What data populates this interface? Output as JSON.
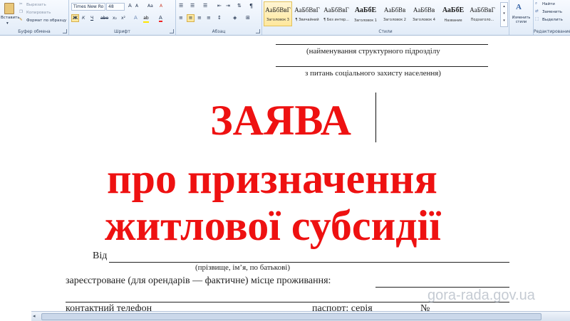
{
  "clipboard": {
    "paste": "Вставить",
    "cut": "Вырезать",
    "copy": "Копировать",
    "format_painter": "Формат по образцу",
    "label": "Буфер обмена"
  },
  "font": {
    "family": "Times New Ro",
    "size": "48",
    "label": "Шрифт",
    "bold": "Ж",
    "italic": "К",
    "underline": "Ч",
    "grow": "A",
    "shrink": "A",
    "case": "Aa",
    "clear": "A"
  },
  "paragraph": {
    "label": "Абзац",
    "pilcrow": "¶"
  },
  "styles": {
    "label": "Стили",
    "items": [
      {
        "preview": "АаБбВвГ",
        "name": "Заголовок 3"
      },
      {
        "preview": "АаБбВвГ",
        "name": "¶ Звичайний"
      },
      {
        "preview": "АаБбВвГ",
        "name": "¶ Без интер..."
      },
      {
        "preview": "АаБбЕ",
        "name": "Заголовок 1"
      },
      {
        "preview": "АаБбВв",
        "name": "Заголовок 2"
      },
      {
        "preview": "АаБбВв",
        "name": "Заголовок 4"
      },
      {
        "preview": "АаБбЕ",
        "name": "Название"
      },
      {
        "preview": "АаБбВвГ",
        "name": "Подзаголо..."
      }
    ],
    "change": "Изменить стили"
  },
  "editing": {
    "find": "Найти",
    "replace": "Заменить",
    "select": "Выделить",
    "label": "Редактирование"
  },
  "document": {
    "unit_caption": "(найменування структурного підрозділу",
    "social_caption": "з питань соціального захисту населення)",
    "title1": "ЗАЯВА",
    "title2": "про призначення",
    "title3": "житлової субсидії",
    "from": "Від",
    "name_caption": "(прізвище, ім’я, по батькові)",
    "registered": "зареєстроване (для орендарів — фактичне) місце проживання:",
    "phone": "контактний телефон",
    "passport": "паспорт: серія",
    "number": "№"
  },
  "watermark": "gora-rada.gov.ua"
}
